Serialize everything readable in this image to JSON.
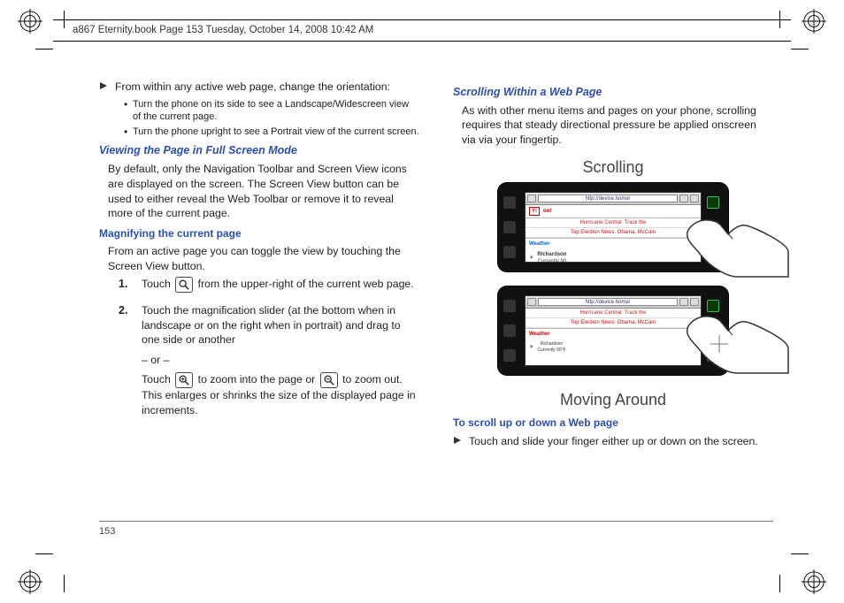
{
  "header": {
    "doc_title": "a867 Eternity.book  Page 153  Tuesday, October 14, 2008  10:42 AM"
  },
  "page_number": "153",
  "left": {
    "intro_line": "From within any active web page, change the orientation:",
    "bullets": [
      "Turn the phone on its side to see a Landscape/Widescreen view of the current page.",
      "Turn the phone upright to see a Portrait view of the current screen."
    ],
    "h1": "Viewing the Page in Full Screen Mode",
    "p1": "By default, only the Navigation Toolbar and Screen View icons are displayed on the screen. The Screen View button can be used to either reveal the Web Toolbar or remove it to reveal more of the current page.",
    "h2": "Magnifying the current page",
    "p2": "From an active page you can toggle the view by touching the Screen View button.",
    "step1_pre": "Touch ",
    "step1_post": " from the upper-right of the current web page.",
    "step2a": "Touch the magnification slider (at the bottom when in landscape or on the right when in portrait) and drag to one side or another",
    "step2or": "– or –",
    "step2b_pre": "Touch ",
    "step2b_mid": " to zoom into the page or ",
    "step2b_post": " to zoom out. This enlarges or shrinks the size of the displayed page in increments."
  },
  "right": {
    "h1": "Scrolling Within a Web Page",
    "p1": "As with other menu items and pages on your phone, scrolling requires that steady directional pressure be applied onscreen via via your fingertip.",
    "fig1_label": "Scrolling",
    "fig2_label": "Moving Around",
    "h2": "To scroll up or down a Web page",
    "step": "Touch and slide your finger either up or down on the screen.",
    "phone_url": "http://device.home/",
    "phone_news1a": "Hurricane Central: Track the",
    "phone_news1b": "Top Election News: Obama, McCain",
    "phone_weather_city": "Richardson",
    "phone_weather_cond": "Currently 90",
    "phone2_news1": "Hurricane Central: Track the",
    "phone2_news2": "Top Election News: Obama, McCain",
    "phone2_weather": "Weather"
  }
}
